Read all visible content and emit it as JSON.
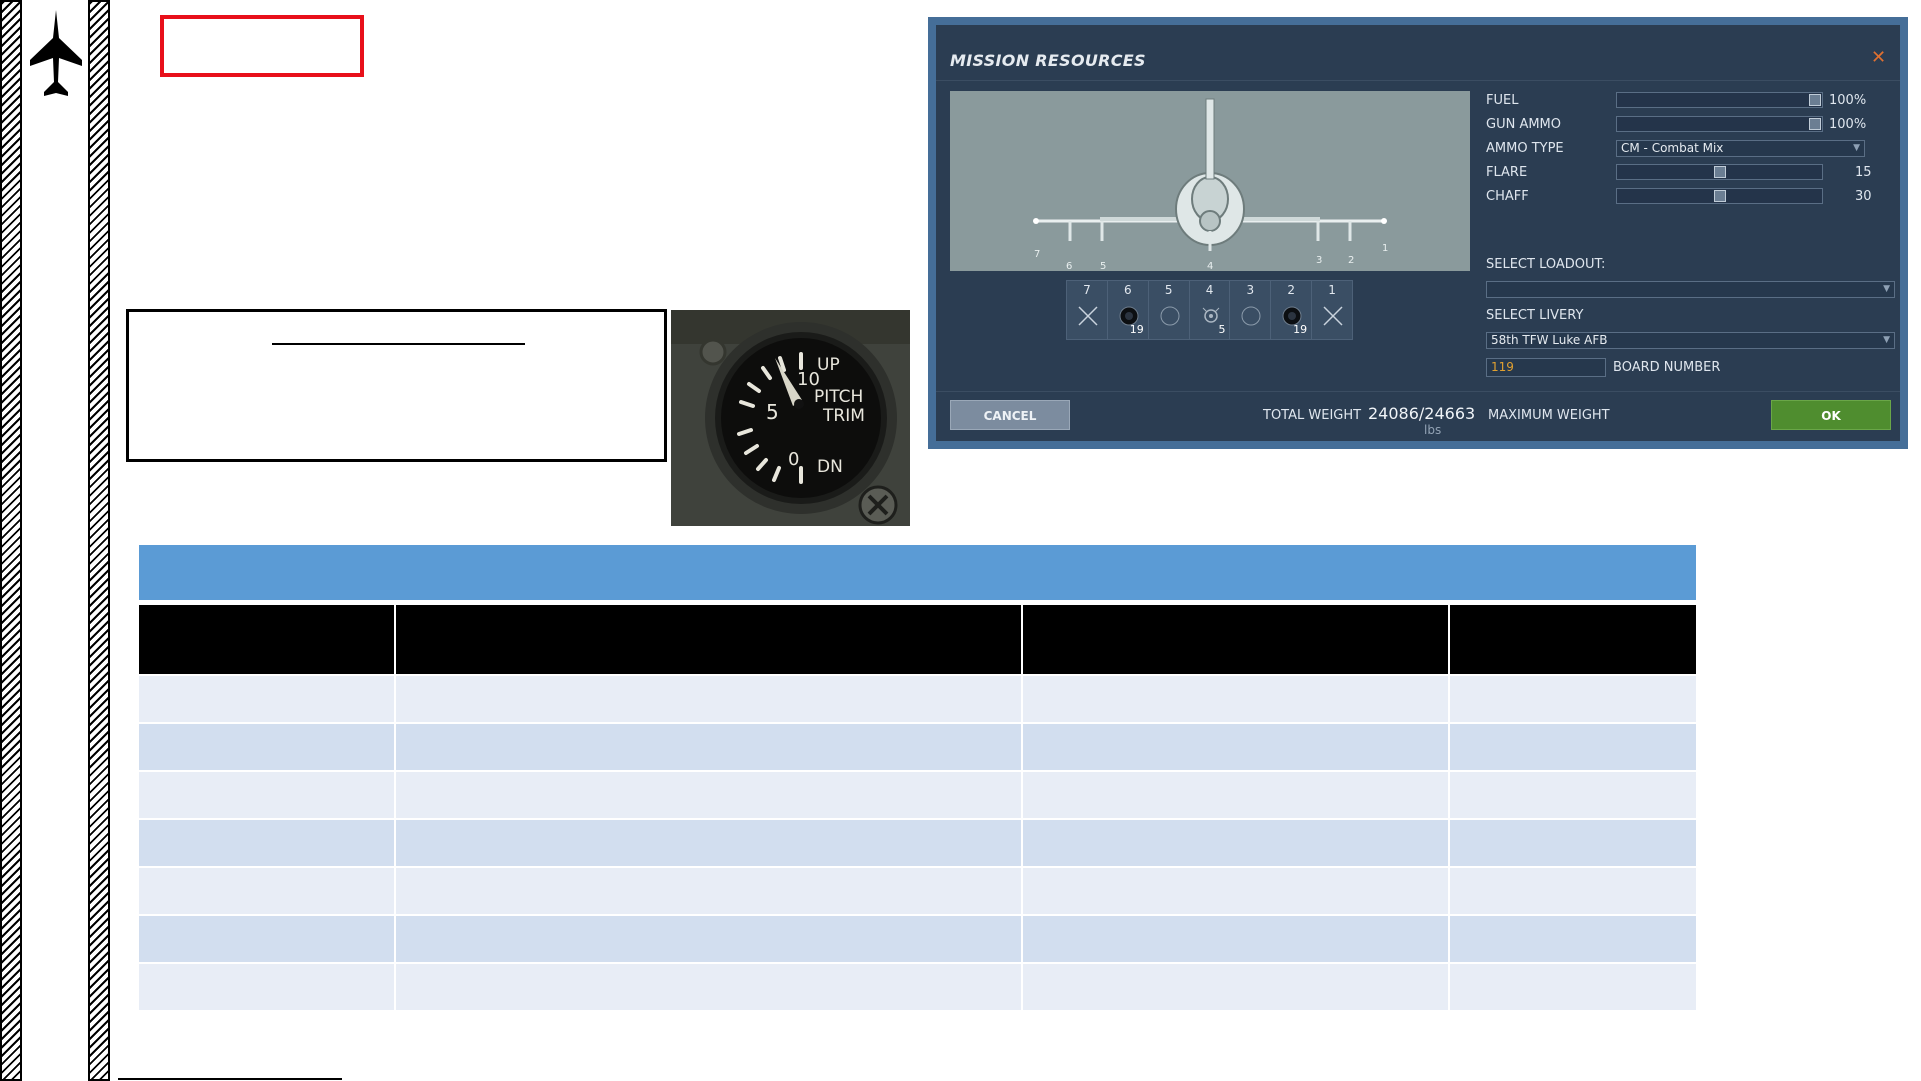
{
  "dialog": {
    "title": "MISSION RESOURCES",
    "close_icon": "close-icon",
    "fuel": {
      "label": "FUEL",
      "value": "100%",
      "level": 1.0
    },
    "gun_ammo": {
      "label": "GUN AMMO",
      "value": "100%",
      "level": 1.0
    },
    "ammo_type": {
      "label": "AMMO TYPE",
      "value": "CM - Combat Mix"
    },
    "flare": {
      "label": "FLARE",
      "value": "15",
      "level": 0.5
    },
    "chaff": {
      "label": "CHAFF",
      "value": "30",
      "level": 0.5
    },
    "select_loadout": {
      "label": "SELECT LOADOUT:",
      "value": ""
    },
    "select_livery": {
      "label": "SELECT LIVERY",
      "value": "58th TFW Luke AFB"
    },
    "board_number": {
      "label": "BOARD NUMBER",
      "value": "119"
    },
    "pylons": [
      {
        "number": "7",
        "icon": "empty-pylon-icon",
        "qty": ""
      },
      {
        "number": "6",
        "icon": "rocket-pod-icon",
        "qty": "19"
      },
      {
        "number": "5",
        "icon": "empty-station-icon",
        "qty": ""
      },
      {
        "number": "4",
        "icon": "bomb-cluster-icon",
        "qty": "5"
      },
      {
        "number": "3",
        "icon": "empty-station-icon",
        "qty": ""
      },
      {
        "number": "2",
        "icon": "rocket-pod-icon",
        "qty": "19"
      },
      {
        "number": "1",
        "icon": "empty-pylon-icon",
        "qty": ""
      }
    ],
    "hardpoint_labels": [
      "7",
      "6",
      "5",
      "4",
      "3",
      "2",
      "1"
    ],
    "total_weight": {
      "label": "TOTAL WEIGHT",
      "value": "24086/24663",
      "unit": "lbs"
    },
    "maximum_weight": {
      "label": "MAXIMUM WEIGHT"
    },
    "cancel": "CANCEL",
    "ok": "OK"
  },
  "gauge": {
    "labels": {
      "up": "UP",
      "pitch": "PITCH",
      "trim": "TRIM",
      "dn": "DN",
      "ten": "10",
      "five": "5",
      "zero": "0"
    }
  },
  "colors": {
    "table_header": "#5b9bd5",
    "table_head_row": "#000000",
    "row_light": "#e8edf6",
    "row_dark": "#d2deef",
    "ok_button": "#4f8d2f",
    "highlight_box": "#e8101a"
  }
}
